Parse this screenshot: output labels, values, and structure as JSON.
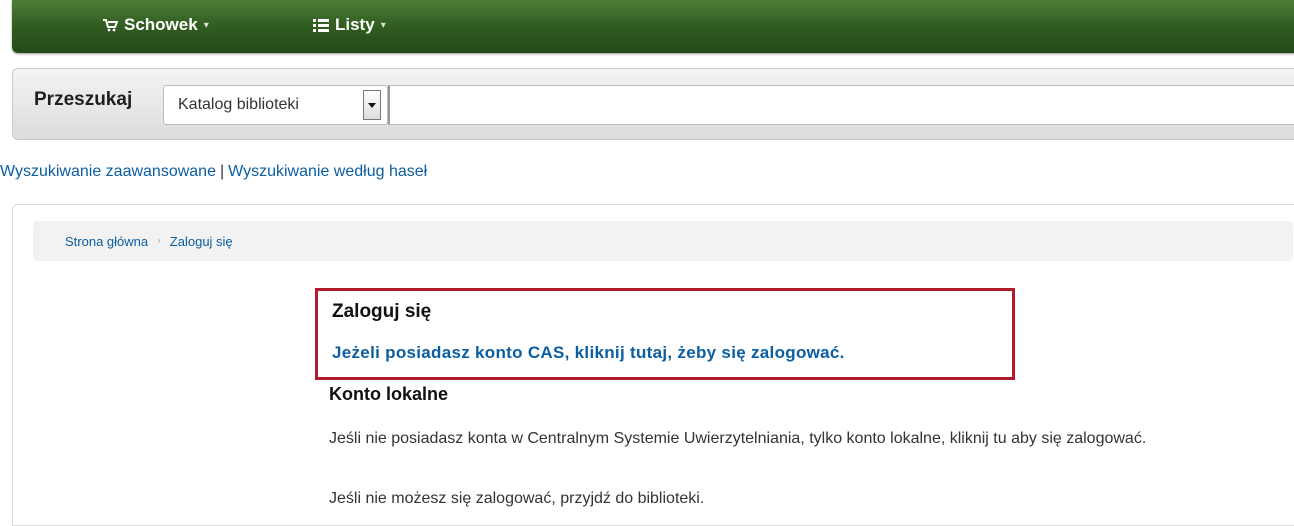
{
  "nav": {
    "items": [
      {
        "label": "Schowek",
        "icon": "cart-icon"
      },
      {
        "label": "Listy",
        "icon": "list-icon"
      }
    ],
    "bg_color": "#2f5a1f"
  },
  "search": {
    "label": "Przeszukaj",
    "scope_selected": "Katalog biblioteki",
    "query": "",
    "placeholder": ""
  },
  "links": {
    "advanced_search": "Wyszukiwanie zaawansowane",
    "separator": "|",
    "subject_search": "Wyszukiwanie według haseł"
  },
  "breadcrumb": {
    "home": "Strona główna",
    "current": "Zaloguj się"
  },
  "login": {
    "title": "Zaloguj się",
    "cas_link": "Jeżeli posiadasz konto CAS, kliknij tutaj, żeby się zalogować.",
    "highlight_color": "#b01c2e",
    "local_heading": "Konto lokalne",
    "local_text": "Jeśli nie posiadasz konta w Centralnym Systemie Uwierzytelniania, tylko konto lokalne, kliknij tu aby się zalogować.",
    "visit_text": "Jeśli nie możesz się zalogować, przyjdź do biblioteki."
  }
}
